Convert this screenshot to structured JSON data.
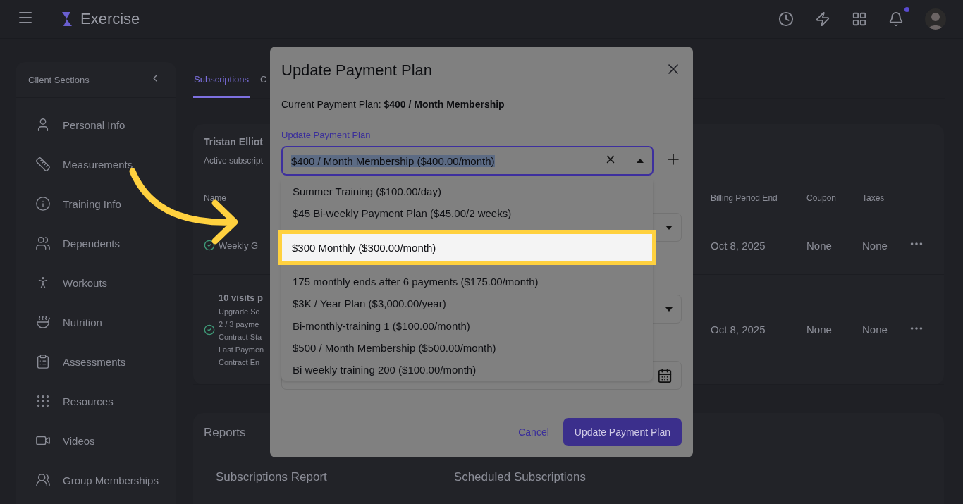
{
  "header": {
    "app_name": "Exercise"
  },
  "sidebar": {
    "title": "Client Sections",
    "items": [
      {
        "label": "Personal Info"
      },
      {
        "label": "Measurements"
      },
      {
        "label": "Training Info"
      },
      {
        "label": "Dependents"
      },
      {
        "label": "Workouts"
      },
      {
        "label": "Nutrition"
      },
      {
        "label": "Assessments"
      },
      {
        "label": "Resources"
      },
      {
        "label": "Videos"
      },
      {
        "label": "Group Memberships"
      }
    ]
  },
  "tabs": [
    {
      "label": "Subscriptions",
      "selected": true
    },
    {
      "label": "C",
      "selected": false
    }
  ],
  "subscriptions_card": {
    "title": "Tristan Elliot",
    "subtitle": "Active subscript",
    "columns": [
      "Name",
      "Billing Period End",
      "Coupon",
      "Taxes"
    ],
    "rows": [
      {
        "name": "Weekly G",
        "details": [],
        "billing_period_end": "Oct 8, 2025",
        "coupon": "None",
        "taxes": "None"
      },
      {
        "name": "10 visits p",
        "details": [
          "Upgrade Sc",
          "2 / 3 payme",
          "Contract Sta",
          "Last Paymen",
          "Contract En"
        ],
        "billing_period_end": "Oct 8, 2025",
        "coupon": "None",
        "taxes": "None"
      }
    ]
  },
  "reports": {
    "title": "Reports",
    "cards": [
      "Subscriptions Report",
      "Scheduled Subscriptions"
    ]
  },
  "modal": {
    "title": "Update Payment Plan",
    "current_plan": "Current Payment Plan: **$400 / Month Membership**",
    "select_label": "Update Payment Plan",
    "select_value": "$400 / Month Membership ($400.00/month)",
    "value_selected": true,
    "options": [
      {
        "label": "Summer Training ($100.00/day)",
        "highlighted": false
      },
      {
        "label": "$45 Bi-weekly Payment Plan ($45.00/2 weeks)",
        "highlighted": false
      },
      {
        "label": "$300 Monthly ($300.00/month)",
        "highlighted": true
      },
      {
        "label": "175 monthly ends after 6 payments ($175.00/month)",
        "highlighted": false
      },
      {
        "label": "$3K / Year Plan ($3,000.00/year)",
        "highlighted": false
      },
      {
        "label": "Bi-monthly-training 1 ($100.00/month)",
        "highlighted": false
      },
      {
        "label": "$500 / Month Membership ($500.00/month)",
        "highlighted": false
      },
      {
        "label": "Bi weekly training 200 ($100.00/month)",
        "highlighted": false
      }
    ],
    "cancel": "Cancel",
    "submit": "Update Payment Plan"
  }
}
